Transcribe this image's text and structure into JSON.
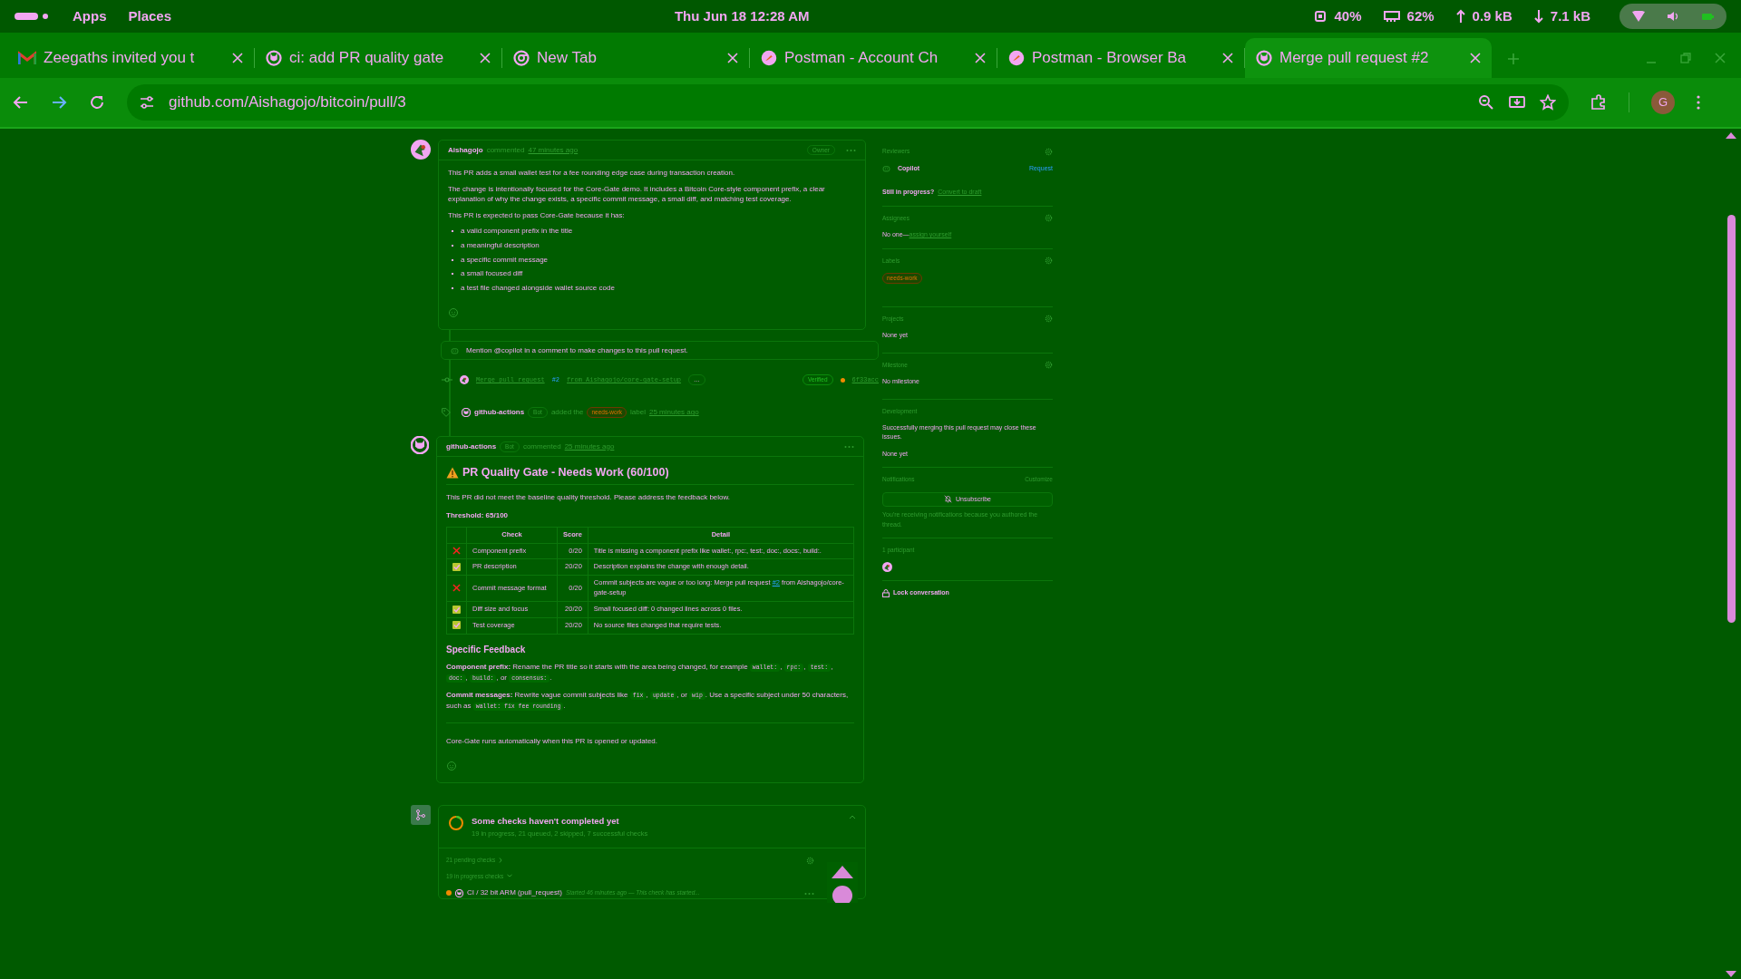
{
  "system_bar": {
    "menus": [
      "Apps",
      "Places"
    ],
    "clock": "Thu Jun 18  12:28 AM",
    "cpu": "40%",
    "memory": "62%",
    "upload": "0.9 kB",
    "download": "7.1 kB"
  },
  "tabs": [
    {
      "title": "Zeegaths invited you t",
      "kind": "mail",
      "selected": false
    },
    {
      "title": "ci: add PR quality gate",
      "kind": "github",
      "selected": false
    },
    {
      "title": "New Tab",
      "kind": "chrome",
      "selected": false
    },
    {
      "title": "Postman - Account Ch",
      "kind": "postman",
      "selected": false
    },
    {
      "title": "Postman - Browser Ba",
      "kind": "postman",
      "selected": false
    },
    {
      "title": "Merge pull request #2",
      "kind": "github",
      "selected": true
    }
  ],
  "address_bar": {
    "url": "github.com/Aishagojo/bitcoin/pull/3",
    "avatar": "G"
  },
  "author_comment": {
    "author": "Aishagojo",
    "action": "commented",
    "time": "47 minutes ago",
    "badge": "Owner",
    "paragraphs": [
      "This PR adds a small wallet test for a fee rounding edge case during transaction creation.",
      "The change is intentionally focused for the Core-Gate demo. It includes a Bitcoin Core-style component prefix, a clear explanation of why the change exists, a specific commit message, a small diff, and matching test coverage.",
      "This PR is expected to pass Core-Gate because it has:"
    ],
    "bullets": [
      "a valid component prefix in the title",
      "a meaningful description",
      "a specific commit message",
      "a small focused diff",
      "a test file changed alongside wallet source code"
    ]
  },
  "copilot_notice": "Mention @copilot in a comment to make changes to this pull request.",
  "commit": {
    "message": "Merge pull request",
    "ref": "#2",
    "branch": "from Aishagojo/core-gate-setup",
    "ellipsis": "…",
    "verified": "Verified",
    "sha": "6f33acc"
  },
  "label_event": {
    "actor": "github-actions",
    "badge": "Bot",
    "action": "added the",
    "label": "needs-work",
    "suffix": "label",
    "time": "25 minutes ago"
  },
  "bot_comment": {
    "author": "github-actions",
    "badge": "Bot",
    "action": "commented",
    "time": "25 minutes ago",
    "heading": "PR Quality Gate - Needs Work (60/100)",
    "intro": "This PR did not meet the baseline quality threshold. Please address the feedback below.",
    "threshold": "Threshold: 65/100",
    "table": {
      "columns": [
        "Check",
        "Score",
        "Detail"
      ],
      "rows": [
        {
          "passed": false,
          "check": "Component prefix",
          "score": "0/20",
          "detail": "Title is missing a component prefix like wallet:, rpc:, test:, doc:, docs:, build:."
        },
        {
          "passed": true,
          "check": "PR description",
          "score": "20/20",
          "detail": "Description explains the change with enough detail."
        },
        {
          "passed": false,
          "check": "Commit message format",
          "score": "0/20",
          "detail": "Commit subjects are vague or too long: Merge pull request",
          "link": "#2",
          "detail_end": "from Aishagojo/core-gate-setup"
        },
        {
          "passed": true,
          "check": "Diff size and focus",
          "score": "20/20",
          "detail": "Small focused diff: 0 changed lines across 0 files."
        },
        {
          "passed": true,
          "check": "Test coverage",
          "score": "20/20",
          "detail": "No source files changed that require tests."
        }
      ]
    },
    "feedback_heading": "Specific Feedback",
    "feedback": [
      [
        {
          "kind": "text",
          "text": "**Component prefix:** Rename the PR title so it starts with the area being changed, for example "
        },
        {
          "kind": "code",
          "text": "wallet:"
        },
        {
          "kind": "text",
          "text": ", "
        },
        {
          "kind": "code",
          "text": "rpc:"
        },
        {
          "kind": "text",
          "text": ", "
        },
        {
          "kind": "code",
          "text": "test:"
        },
        {
          "kind": "text",
          "text": ", "
        },
        {
          "kind": "code",
          "text": "doc:"
        },
        {
          "kind": "text",
          "text": ", "
        },
        {
          "kind": "code",
          "text": "build:"
        },
        {
          "kind": "text",
          "text": ", or "
        },
        {
          "kind": "code",
          "text": "consensus:"
        },
        {
          "kind": "text",
          "text": "."
        }
      ],
      [
        {
          "kind": "text",
          "text": "**Commit messages:** Rewrite vague commit subjects like "
        },
        {
          "kind": "code",
          "text": "fix"
        },
        {
          "kind": "text",
          "text": ", "
        },
        {
          "kind": "code",
          "text": "update"
        },
        {
          "kind": "text",
          "text": ", or "
        },
        {
          "kind": "code",
          "text": "wip"
        },
        {
          "kind": "text",
          "text": ". Use a specific subject under 50 characters, such as "
        },
        {
          "kind": "code",
          "text": "wallet: fix fee rounding"
        },
        {
          "kind": "text",
          "text": "."
        }
      ]
    ],
    "footer": "Core-Gate runs automatically when this PR is opened or updated."
  },
  "checks": {
    "title": "Some checks haven't completed yet",
    "summary": "19 in progress, 21 queued, 2 skipped, 7 successful checks",
    "pending": "21 pending checks",
    "in_progress": "19 in progress checks",
    "rows": [
      {
        "name": "CI / 32 bit ARM (pull_request)",
        "note": "Started 46 minutes ago — This check has started..."
      }
    ]
  },
  "sidebar": {
    "reviewers": {
      "label": "Reviewers",
      "name": "Copilot",
      "request": "Request",
      "draft_prompt": "Still in progress?",
      "draft_link": "Convert to draft"
    },
    "assignees": {
      "label": "Assignees",
      "text": "No one—",
      "link": "assign yourself"
    },
    "labels": {
      "label": "Labels",
      "items": [
        "needs-work"
      ]
    },
    "projects": {
      "label": "Projects",
      "text": "None yet"
    },
    "milestone": {
      "label": "Milestone",
      "text": "No milestone"
    },
    "development": {
      "label": "Development",
      "text": "Successfully merging this pull request may close these issues.",
      "value": "None yet"
    },
    "notifications": {
      "label": "Notifications",
      "customize": "Customize",
      "button": "Unsubscribe",
      "note": "You're receiving notifications because you authored the thread."
    },
    "participants": {
      "label": "1 participant"
    },
    "lock": "Lock conversation"
  }
}
